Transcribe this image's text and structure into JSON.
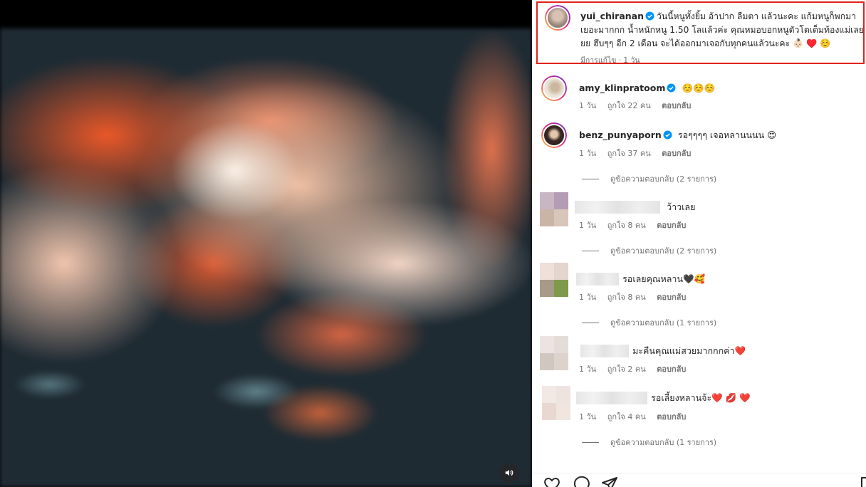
{
  "post": {
    "username": "yui_chiranan",
    "caption": "วันนี้หนูทั้งยิ้ม อ้าปาก ลืมตา แล้วนะคะ แก้มหนูก็พกมาเยอะมากกก น้ำหนักหนู 1.50 โลแล้วค่ะ คุณหมอบอกหนูตัวโตเต็มท้องแม่เลยยย ฮึบๆๆ อีก 2 เดือน จะได้ออกมาเจอกับทุกคนแล้วนะคะ 👶🏻 ♥️ ☺️",
    "edited_label": "มีการแก้ไข",
    "time": "1 วัน"
  },
  "comments": [
    {
      "username": "amy_klinpratoom",
      "verified": true,
      "text": "☺️☺️☺️",
      "time": "1 วัน",
      "likes": "ถูกใจ 22 คน",
      "reply_label": "ตอบกลับ",
      "view_replies": ""
    },
    {
      "username": "benz_punyaporn",
      "verified": true,
      "text": "รอๆๆๆๆ เจอหลานนนน 😍",
      "time": "1 วัน",
      "likes": "ถูกใจ 37 คน",
      "reply_label": "ตอบกลับ",
      "view_replies": "ดูข้อความตอบกลับ (2 รายการ)"
    },
    {
      "username": "",
      "verified": false,
      "text": "ว้าวเลย",
      "time": "1 วัน",
      "likes": "ถูกใจ 8 คน",
      "reply_label": "ตอบกลับ",
      "view_replies": "ดูข้อความตอบกลับ (2 รายการ)"
    },
    {
      "username": "",
      "verified": false,
      "text": "รอเลยคุณหลาน🖤🥰",
      "time": "1 วัน",
      "likes": "ถูกใจ 8 คน",
      "reply_label": "ตอบกลับ",
      "view_replies": "ดูข้อความตอบกลับ (1 รายการ)"
    },
    {
      "username": "",
      "verified": false,
      "text": "มะคืนคุณแม่สวยมากกกค่า❤️",
      "time": "1 วัน",
      "likes": "ถูกใจ 2 คน",
      "reply_label": "ตอบกลับ",
      "view_replies": ""
    },
    {
      "username": "",
      "verified": false,
      "text": "รอเลี้ยงหลานจ้ะ❤️ 💋 ❤️",
      "time": "1 วัน",
      "likes": "ถูกใจ 4 คน",
      "reply_label": "ตอบกลับ",
      "view_replies": "ดูข้อความตอบกลับ (1 รายการ)"
    }
  ],
  "icons": {
    "mute": "speaker-icon",
    "like": "heart-icon",
    "comment": "comment-icon",
    "share": "share-icon",
    "save": "bookmark-icon",
    "verified": "verified-badge-icon"
  },
  "colors": {
    "highlight_border": "#e0231b",
    "verified_blue": "#0095f6",
    "muted_text": "#737373"
  }
}
